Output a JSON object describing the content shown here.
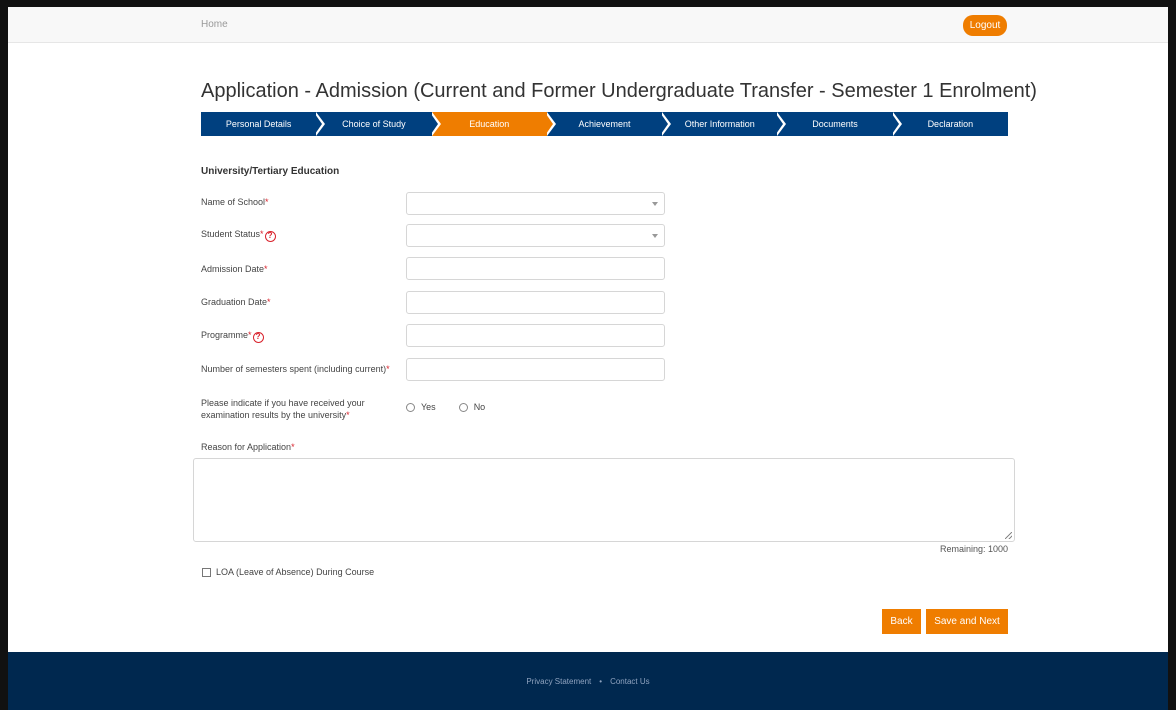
{
  "topbar": {
    "home_label": "Home",
    "logout_label": "Logout"
  },
  "page_title": "Application - Admission  (Current and Former Undergraduate Transfer - Semester 1 Enrolment)",
  "steps": [
    {
      "label": "Personal Details",
      "active": false
    },
    {
      "label": "Choice of Study",
      "active": false
    },
    {
      "label": "Education",
      "active": true
    },
    {
      "label": "Achievement",
      "active": false
    },
    {
      "label": "Other Information",
      "active": false
    },
    {
      "label": "Documents",
      "active": false
    },
    {
      "label": "Declaration",
      "active": false
    }
  ],
  "section_heading": "University/Tertiary Education",
  "fields": {
    "name_of_school": {
      "label": "Name of School",
      "value": ""
    },
    "student_status": {
      "label": "Student Status",
      "value": ""
    },
    "admission_date": {
      "label": "Admission Date",
      "value": ""
    },
    "graduation_date": {
      "label": "Graduation Date",
      "value": ""
    },
    "programme": {
      "label": "Programme",
      "value": ""
    },
    "semesters_spent": {
      "label": "Number of semesters spent (including current)",
      "value": ""
    },
    "exam_results": {
      "label_line1": "Please indicate if you have received your",
      "label_line2": "examination results by the university",
      "options": [
        "Yes",
        "No"
      ],
      "selected": null
    },
    "reason": {
      "label": "Reason for Application",
      "value": "",
      "remaining": "Remaining: 1000"
    }
  },
  "required_mark": "*",
  "help_glyph": "?",
  "loa_checkbox": {
    "label": "LOA (Leave of Absence) During Course",
    "checked": false
  },
  "buttons": {
    "back_label": "Back",
    "save_next_label": "Save and Next"
  },
  "footer": {
    "privacy_label": "Privacy Statement",
    "separator": "•",
    "contact_label": "Contact Us"
  },
  "colors": {
    "accent": "#ef7d00",
    "step_bar": "#00407f",
    "footer": "#00284f",
    "required": "#d9232d"
  }
}
